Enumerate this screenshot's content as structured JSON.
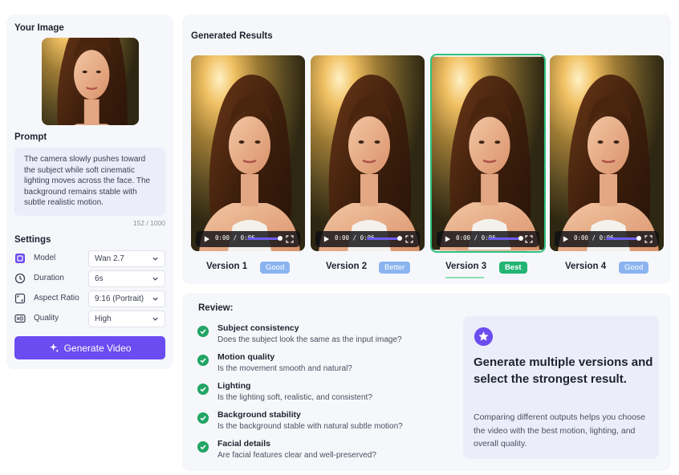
{
  "left_panel": {
    "image_title": "Your Image",
    "prompt_title": "Prompt",
    "prompt_text": "The camera slowly pushes toward the subject while soft cinematic lighting moves across the face. The background remains stable with subtle realistic motion.",
    "char_count": "152 / 1000",
    "settings_title": "Settings",
    "settings": [
      {
        "label": "Model",
        "value": "Wan 2.7",
        "icon": "model-icon"
      },
      {
        "label": "Duration",
        "value": "6s",
        "icon": "clock-icon"
      },
      {
        "label": "Aspect Ratio",
        "value": "9:16 (Portrait)",
        "icon": "aspect-ratio-icon"
      },
      {
        "label": "Quality",
        "value": "High",
        "icon": "hd-icon"
      }
    ],
    "generate_button": "Generate Video"
  },
  "results": {
    "title": "Generated Results",
    "player_time": "0:00 / 0:06",
    "versions": [
      {
        "label": "Version 1",
        "badge": "Good"
      },
      {
        "label": "Version 2",
        "badge": "Better"
      },
      {
        "label": "Version 3",
        "badge": "Best"
      },
      {
        "label": "Version 4",
        "badge": "Good"
      }
    ]
  },
  "review": {
    "title": "Review:",
    "criteria": [
      {
        "title": "Subject consistency",
        "desc": "Does the subject look the same as the input image?"
      },
      {
        "title": "Motion quality",
        "desc": "Is the movement smooth and natural?"
      },
      {
        "title": "Lighting",
        "desc": "Is the lighting soft, realistic, and consistent?"
      },
      {
        "title": "Background stability",
        "desc": "Is the background stable with natural subtle motion?"
      },
      {
        "title": "Facial details",
        "desc": "Are facial features clear and well-preserved?"
      }
    ],
    "tip_heading": "Generate multiple versions and select the strongest result.",
    "tip_body": "Comparing different outputs helps you choose the video with the best motion, lighting, and overall quality."
  },
  "colors": {
    "accent": "#6a4cf0",
    "best_green": "#22b573",
    "badge_blue": "#8ab4f0",
    "check_green": "#22a565"
  }
}
